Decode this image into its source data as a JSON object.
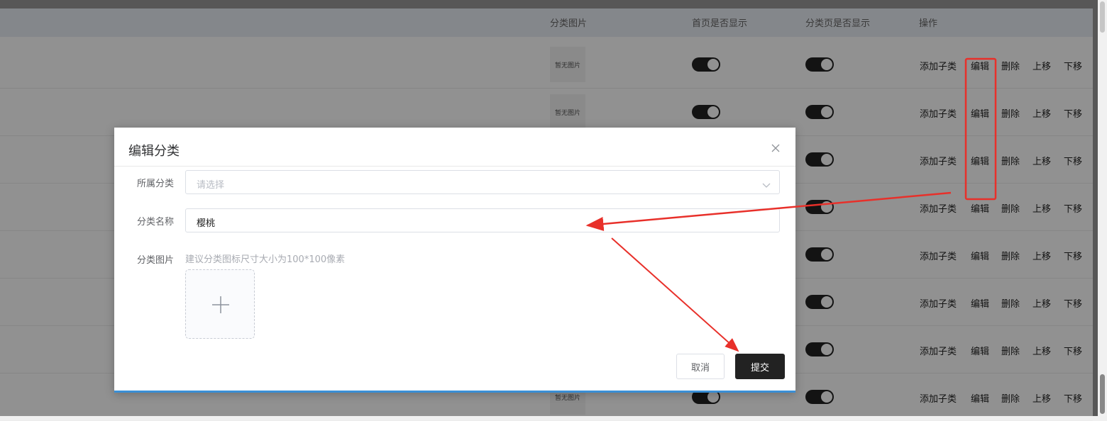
{
  "table": {
    "headers": {
      "image": "分类图片",
      "home_show": "首页是否显示",
      "category_show": "分类页是否显示",
      "actions": "操作"
    },
    "no_image_text": "暂无图片",
    "row_actions": {
      "add_child": "添加子类",
      "edit": "编辑",
      "delete": "删除",
      "move_up": "上移",
      "move_down": "下移"
    }
  },
  "modal": {
    "title": "编辑分类",
    "fields": {
      "parent": {
        "label": "所属分类",
        "placeholder": "请选择"
      },
      "name": {
        "label": "分类名称",
        "value": "樱桃"
      },
      "image": {
        "label": "分类图片",
        "hint": "建议分类图标尺寸大小为100*100像素"
      }
    },
    "buttons": {
      "cancel": "取消",
      "submit": "提交"
    }
  },
  "colors": {
    "annotation": "#e8302a",
    "submit": "#222222",
    "accent_bar": "#3a8fd6"
  },
  "icons": {
    "close": "close-icon",
    "chevron": "chevron-down-icon",
    "plus": "plus-icon"
  }
}
